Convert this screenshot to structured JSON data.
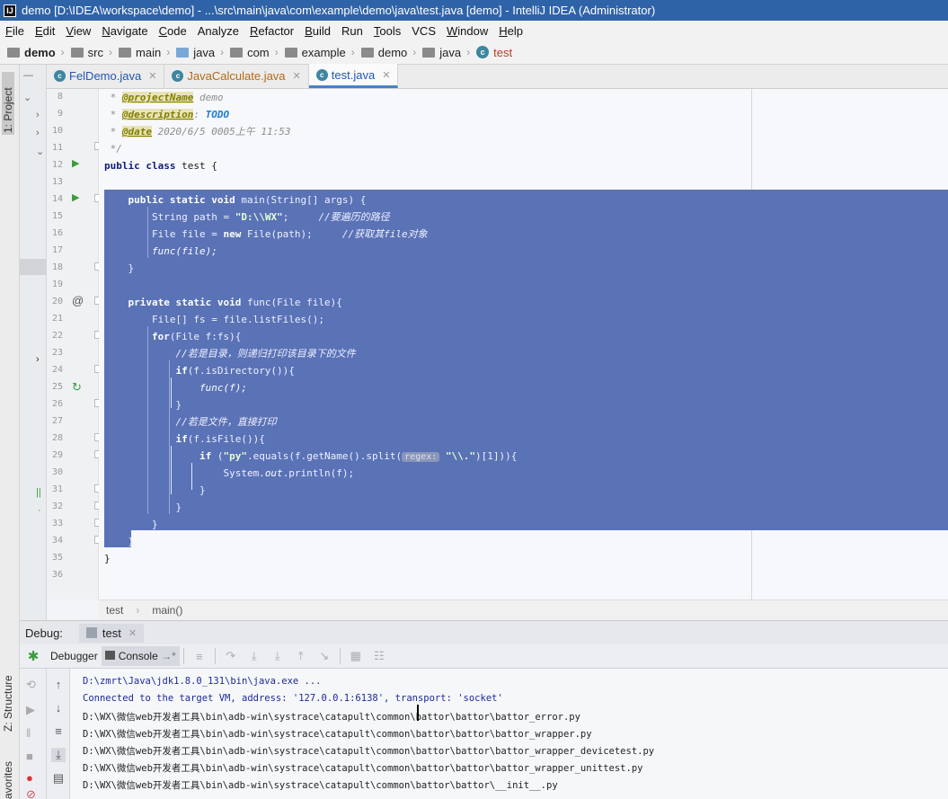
{
  "window": {
    "app_icon": "IJ",
    "title": "demo [D:\\IDEA\\workspace\\demo] - ...\\src\\main\\java\\com\\example\\demo\\java\\test.java [demo] - IntelliJ IDEA (Administrator)"
  },
  "menu": [
    {
      "label": "File",
      "u": "F",
      "rest": "ile"
    },
    {
      "label": "Edit",
      "u": "E",
      "rest": "dit"
    },
    {
      "label": "View",
      "u": "V",
      "rest": "iew"
    },
    {
      "label": "Navigate",
      "u": "N",
      "rest": "avigate"
    },
    {
      "label": "Code",
      "u": "C",
      "rest": "ode"
    },
    {
      "label": "Analyze",
      "u": "",
      "rest": "Analyze"
    },
    {
      "label": "Refactor",
      "u": "R",
      "rest": "efactor"
    },
    {
      "label": "Build",
      "u": "B",
      "rest": "uild"
    },
    {
      "label": "Run",
      "u": "",
      "rest": "Run"
    },
    {
      "label": "Tools",
      "u": "T",
      "rest": "ools"
    },
    {
      "label": "VCS",
      "u": "",
      "rest": "VCS"
    },
    {
      "label": "Window",
      "u": "W",
      "rest": "indow"
    },
    {
      "label": "Help",
      "u": "H",
      "rest": "elp"
    }
  ],
  "breadcrumb": [
    "demo",
    "src",
    "main",
    "java",
    "com",
    "example",
    "demo",
    "java",
    "test"
  ],
  "left_tool_tabs": {
    "project": "1: Project",
    "structure": "Z: Structure",
    "favorites": "avorites"
  },
  "editor_tabs": [
    {
      "label": "FelDemo.java",
      "color": "#2257b0",
      "active": false
    },
    {
      "label": "JavaCalculate.java",
      "color": "#b46a17",
      "active": false
    },
    {
      "label": "test.java",
      "color": "#2257b0",
      "active": true
    }
  ],
  "line_numbers": [
    "8",
    "9",
    "10",
    "11",
    "12",
    "13",
    "14",
    "15",
    "16",
    "17",
    "18",
    "19",
    "20",
    "21",
    "22",
    "23",
    "24",
    "25",
    "26",
    "27",
    "28",
    "29",
    "30",
    "31",
    "32",
    "33",
    "34",
    "35",
    "36"
  ],
  "code": {
    "l8_prefix": " * ",
    "l8_tag": "@projectName",
    "l8_val": " demo",
    "l9_prefix": " * ",
    "l9_tag": "@description",
    "l9_mid": ": ",
    "l9_todo": "TODO",
    "l10_prefix": " * ",
    "l10_tag": "@date",
    "l10_val": " 2020/6/5 0005上午 11:53",
    "l11": " */",
    "l12_kw": "public class",
    "l12_rest": " test {",
    "l14_kw": "    public static void",
    "l14_rest": " main(String[] args) {",
    "l15_a": "        String path = ",
    "l15_str": "\"D:\\\\WX\"",
    "l15_b": ";     ",
    "l15_cmt": "//要遍历的路径",
    "l16_a": "        File file = ",
    "l16_kw": "new",
    "l16_b": " File(path);     ",
    "l16_cmt": "//获取其file对象",
    "l17": "        func(file);",
    "l18": "    }",
    "l20_kw": "    private static void",
    "l20_rest": " func(File file){",
    "l21": "        File[] fs = file.listFiles();",
    "l22_kw": "        for",
    "l22_rest": "(File f:fs){",
    "l23_cmt": "            //若是目录，则递归打印该目录下的文件",
    "l24_kw": "            if",
    "l24_rest": "(f.isDirectory()){",
    "l25": "                func(f);",
    "l26": "            }",
    "l27_cmt": "            //若是文件，直接打印",
    "l28_kw": "            if",
    "l28_rest": "(f.isFile()){",
    "l29_kw": "                if",
    "l29_a": " (",
    "l29_str": "\"py\"",
    "l29_b": ".equals(f.getName().split(",
    "l29_hint": "regex:",
    "l29_str2": " \"\\\\.\"",
    "l29_c": ")[1])){",
    "l30_a": "                    System.",
    "l30_fld": "out",
    "l30_b": ".println(f);",
    "l31": "                }",
    "l32": "            }",
    "l33": "        }",
    "l34": "    }",
    "l35": "}"
  },
  "editor_breadcrumb": [
    "test",
    "main()"
  ],
  "debug": {
    "label": "Debug:",
    "run_config": "test",
    "debugger_tab": "Debugger",
    "console_tab": "Console",
    "console_arrow": "→*"
  },
  "console_lines": [
    "D:\\zmrt\\Java\\jdk1.8.0_131\\bin\\java.exe ...",
    "Connected to the target VM, address: '127.0.0.1:6138', transport: 'socket'",
    "D:\\WX\\微信web开发者工具\\bin\\adb-win\\systrace\\catapult\\common\\battor\\battor\\battor_error.py",
    "D:\\WX\\微信web开发者工具\\bin\\adb-win\\systrace\\catapult\\common\\battor\\battor\\battor_wrapper.py",
    "D:\\WX\\微信web开发者工具\\bin\\adb-win\\systrace\\catapult\\common\\battor\\battor\\battor_wrapper_devicetest.py",
    "D:\\WX\\微信web开发者工具\\bin\\adb-win\\systrace\\catapult\\common\\battor\\battor\\battor_wrapper_unittest.py",
    "D:\\WX\\微信web开发者工具\\bin\\adb-win\\systrace\\catapult\\common\\battor\\battor\\__init__.py"
  ],
  "colors": {
    "titlebar": "#2f63a8",
    "selection": "#5a72b6",
    "run_green": "#3c9c3c",
    "active_tab_underline": "#4083c9"
  },
  "icons": {
    "class": "class-c-icon",
    "folder": "folder-icon",
    "run": "run-gutter-icon",
    "override": "override-at-icon",
    "recursion": "recursive-call-icon",
    "debug": "bug-icon"
  }
}
